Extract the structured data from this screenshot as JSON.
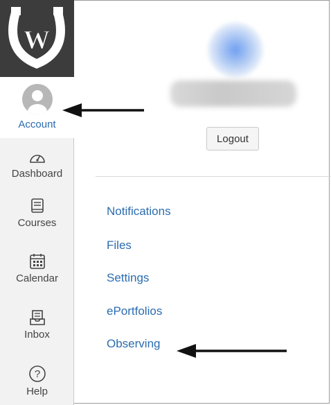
{
  "nav": {
    "logo_letter": "W",
    "items": [
      {
        "label": "Account",
        "icon": "avatar-icon",
        "active": true
      },
      {
        "label": "Dashboard",
        "icon": "speedometer-icon"
      },
      {
        "label": "Courses",
        "icon": "book-icon"
      },
      {
        "label": "Calendar",
        "icon": "calendar-icon"
      },
      {
        "label": "Inbox",
        "icon": "inbox-icon"
      },
      {
        "label": "Help",
        "icon": "help-icon"
      }
    ]
  },
  "account_panel": {
    "logout_label": "Logout",
    "links": [
      "Notifications",
      "Files",
      "Settings",
      "ePortfolios",
      "Observing"
    ]
  },
  "colors": {
    "link": "#2b6cb0",
    "logo_bg": "#3c3c3c",
    "nav_bg": "#f2f2f2",
    "arrow": "#111111"
  }
}
